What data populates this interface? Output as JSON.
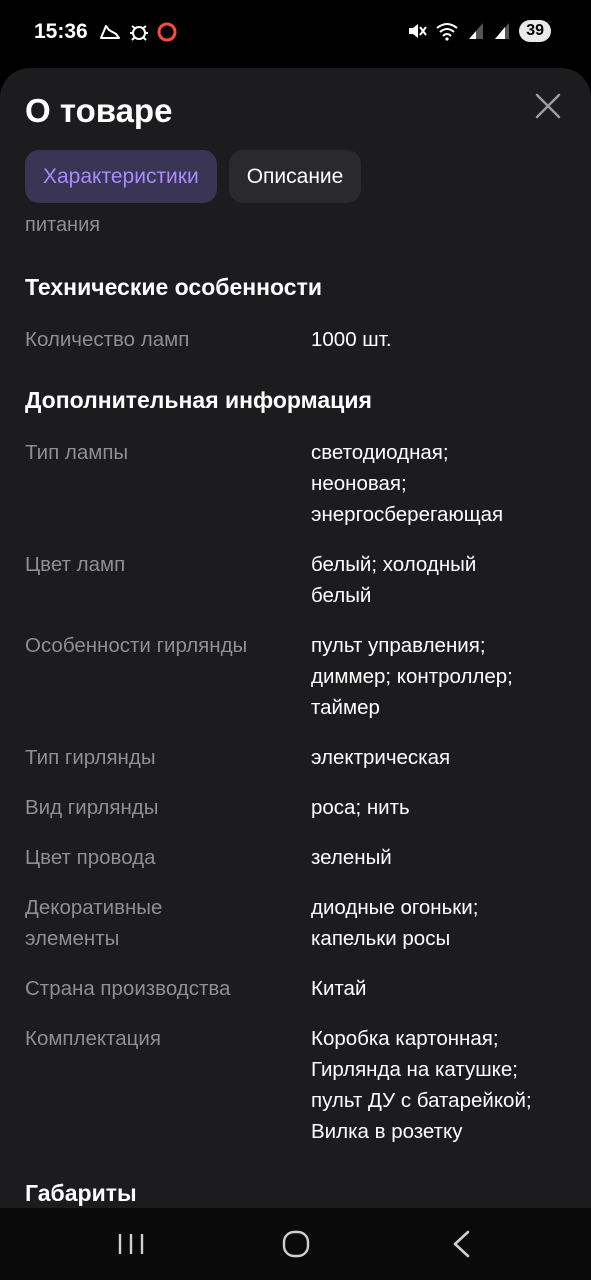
{
  "status": {
    "time": "15:36",
    "battery": "39",
    "left_icons": [
      "shoe-icon",
      "bug-icon",
      "ring-icon"
    ],
    "right_icons": [
      "mute-icon",
      "wifi-icon",
      "signal-icon",
      "signal-icon"
    ]
  },
  "sheet": {
    "title": "О товаре",
    "tabs": [
      {
        "label": "Характеристики",
        "active": true
      },
      {
        "label": "Описание",
        "active": false
      }
    ],
    "cut_text": "питания",
    "sections": [
      {
        "title": "Технические особенности",
        "rows": [
          {
            "label": "Количество ламп",
            "value": "1000 шт."
          }
        ]
      },
      {
        "title": "Дополнительная информация",
        "rows": [
          {
            "label": "Тип лампы",
            "value": "светодиодная;\nнеоновая;\nэнергосберегающая"
          },
          {
            "label": "Цвет ламп",
            "value": "белый; холодный\nбелый"
          },
          {
            "label": "Особенности гирлянды",
            "value": "пульт управления;\nдиммер; контроллер;\nтаймер"
          },
          {
            "label": "Тип гирлянды",
            "value": "электрическая"
          },
          {
            "label": "Вид гирлянды",
            "value": "роса; нить"
          },
          {
            "label": "Цвет провода",
            "value": "зеленый"
          },
          {
            "label": "Декоративные\nэлементы",
            "value": "диодные огоньки;\nкапельки росы"
          },
          {
            "label": "Страна производства",
            "value": "Китай"
          },
          {
            "label": "Комплектация",
            "value": "Коробка картонная;\nГирлянда на катушке;\nпульт ДУ с батарейкой;\nВилка в розетку"
          }
        ]
      },
      {
        "title": "Габариты",
        "rows": []
      }
    ]
  },
  "colors": {
    "sheet_bg": "#1c1c1f",
    "accent": "#a78bfa",
    "label": "#8e8e93"
  }
}
